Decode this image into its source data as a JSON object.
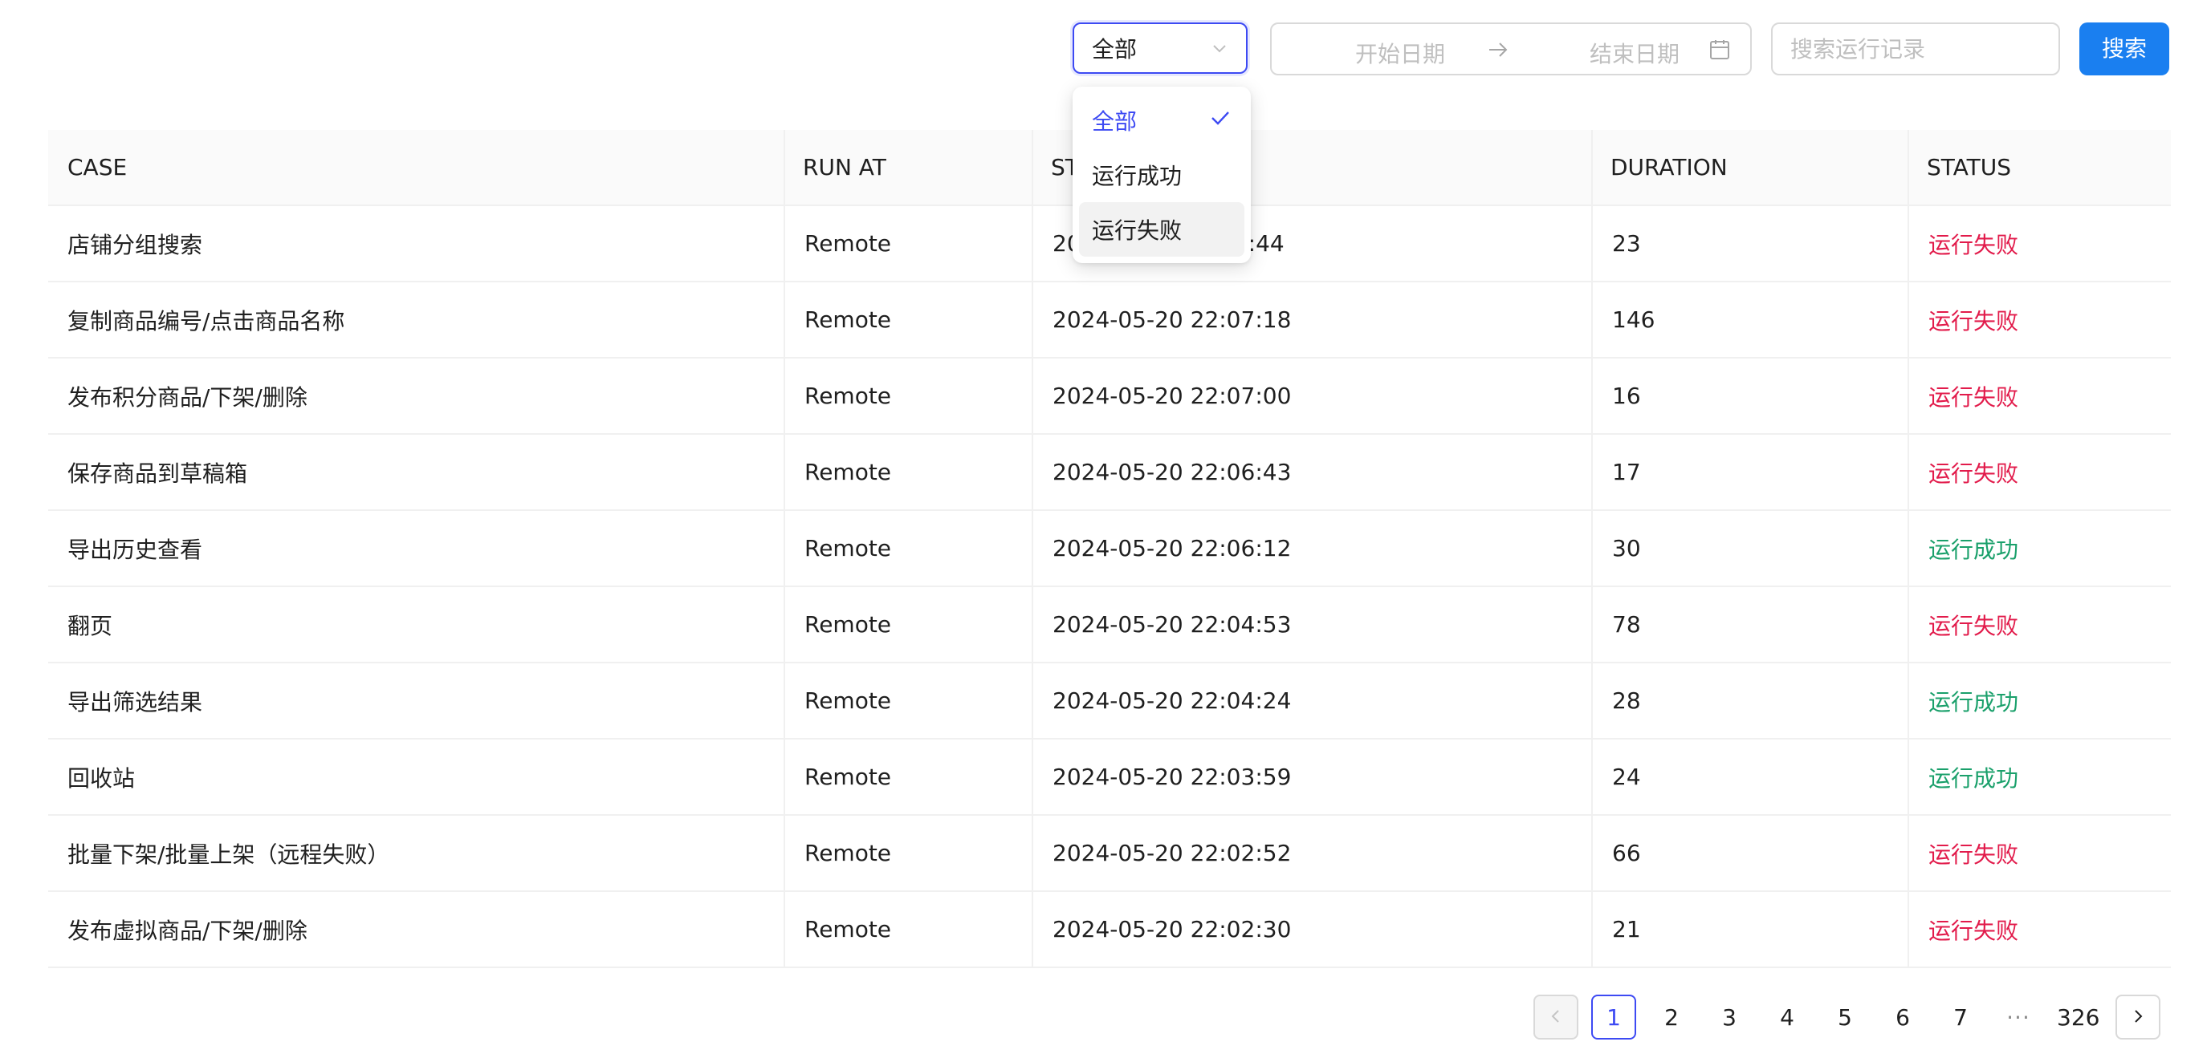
{
  "filters": {
    "status_value": "全部",
    "date_start_placeholder": "开始日期",
    "date_end_placeholder": "结束日期",
    "search_placeholder": "搜索运行记录",
    "search_button": "搜索"
  },
  "dropdown": {
    "options": [
      {
        "label": "全部",
        "selected": true
      },
      {
        "label": "运行成功",
        "selected": false
      },
      {
        "label": "运行失败",
        "selected": false
      }
    ]
  },
  "table": {
    "columns": [
      "CASE",
      "RUN AT",
      "START",
      "DURATION",
      "STATUS"
    ],
    "visible_header": [
      "CASE",
      "RUN AT",
      "ST",
      "DURATION",
      "STATUS"
    ],
    "rows": [
      {
        "case": "店铺分组搜索",
        "run_at": "Remote",
        "start": "20",
        "start_tail": ":44",
        "duration": "23",
        "status": "运行失败",
        "status_type": "fail"
      },
      {
        "case": "复制商品编号/点击商品名称",
        "run_at": "Remote",
        "start": "2024-05-20 22:07:18",
        "duration": "146",
        "status": "运行失败",
        "status_type": "fail"
      },
      {
        "case": "发布积分商品/下架/删除",
        "run_at": "Remote",
        "start": "2024-05-20 22:07:00",
        "duration": "16",
        "status": "运行失败",
        "status_type": "fail"
      },
      {
        "case": "保存商品到草稿箱",
        "run_at": "Remote",
        "start": "2024-05-20 22:06:43",
        "duration": "17",
        "status": "运行失败",
        "status_type": "fail"
      },
      {
        "case": "导出历史查看",
        "run_at": "Remote",
        "start": "2024-05-20 22:06:12",
        "duration": "30",
        "status": "运行成功",
        "status_type": "ok"
      },
      {
        "case": "翻页",
        "run_at": "Remote",
        "start": "2024-05-20 22:04:53",
        "duration": "78",
        "status": "运行失败",
        "status_type": "fail"
      },
      {
        "case": "导出筛选结果",
        "run_at": "Remote",
        "start": "2024-05-20 22:04:24",
        "duration": "28",
        "status": "运行成功",
        "status_type": "ok"
      },
      {
        "case": "回收站",
        "run_at": "Remote",
        "start": "2024-05-20 22:03:59",
        "duration": "24",
        "status": "运行成功",
        "status_type": "ok"
      },
      {
        "case": "批量下架/批量上架（远程失败）",
        "run_at": "Remote",
        "start": "2024-05-20 22:02:52",
        "duration": "66",
        "status": "运行失败",
        "status_type": "fail"
      },
      {
        "case": "发布虚拟商品/下架/删除",
        "run_at": "Remote",
        "start": "2024-05-20 22:02:30",
        "duration": "21",
        "status": "运行失败",
        "status_type": "fail"
      }
    ]
  },
  "pagination": {
    "current": "1",
    "pages": [
      "1",
      "2",
      "3",
      "4",
      "5",
      "6",
      "7"
    ],
    "ellipsis": "···",
    "last": "326"
  },
  "colors": {
    "accent": "#3d4af3",
    "primary_button": "#1a7ff0",
    "fail": "#e21b4b",
    "success": "#1aa06b"
  },
  "icons": {
    "select": "chevron-down-icon",
    "date_separator": "arrow-right-icon",
    "date": "calendar-icon",
    "selected_option": "check-icon",
    "prev_page": "chevron-left-icon",
    "next_page": "chevron-right-icon"
  }
}
